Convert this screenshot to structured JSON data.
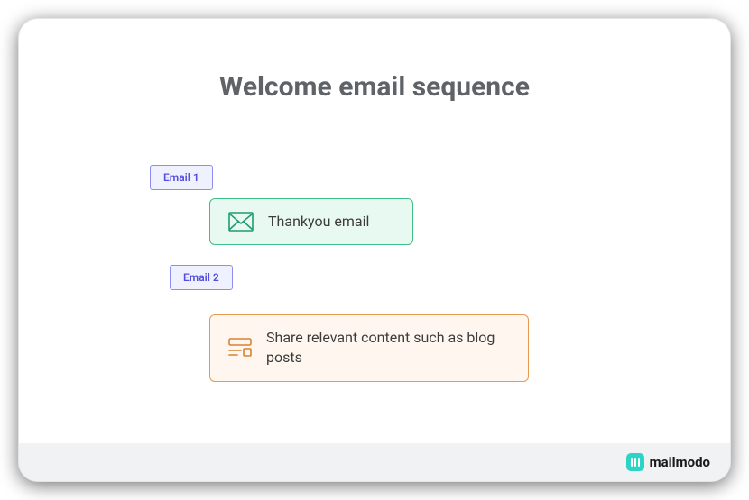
{
  "title": "Welcome email sequence",
  "steps": [
    {
      "tag": "Email 1",
      "label": "Thankyou email"
    },
    {
      "tag": "Email 2",
      "label": "Share relevant content such as blog posts"
    }
  ],
  "brand": {
    "name": "mailmodo"
  },
  "colors": {
    "tag_bg": "#f0f1ff",
    "tag_border": "#8f8cf2",
    "tag_text": "#524fe0",
    "card1_bg": "#e8f9f1",
    "card1_border": "#3dbf87",
    "card2_bg": "#fef6ef",
    "card2_border": "#e89b4e",
    "brand_accent": "#2bd4c4"
  }
}
